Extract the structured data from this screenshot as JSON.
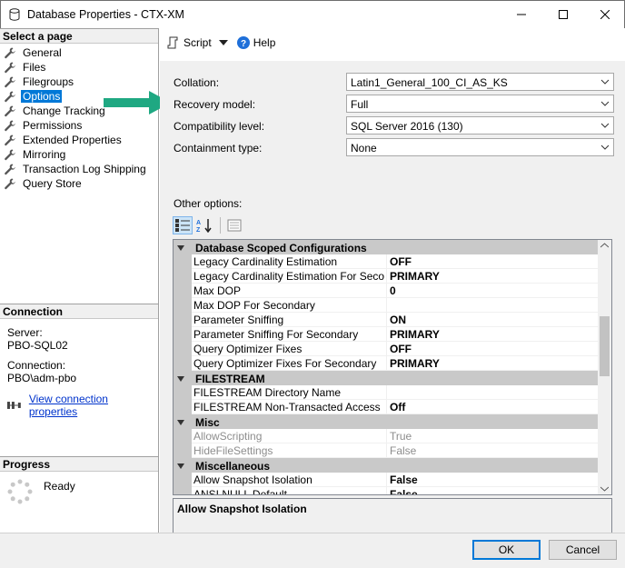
{
  "window": {
    "title": "Database Properties - CTX-XM"
  },
  "left": {
    "select_page_header": "Select a page",
    "pages": [
      {
        "label": "General"
      },
      {
        "label": "Files"
      },
      {
        "label": "Filegroups"
      },
      {
        "label": "Options",
        "selected": true
      },
      {
        "label": "Change Tracking"
      },
      {
        "label": "Permissions"
      },
      {
        "label": "Extended Properties"
      },
      {
        "label": "Mirroring"
      },
      {
        "label": "Transaction Log Shipping"
      },
      {
        "label": "Query Store"
      }
    ],
    "connection_header": "Connection",
    "server_label": "Server:",
    "server_value": "PBO-SQL02",
    "connection_label": "Connection:",
    "connection_value": "PBO\\adm-pbo",
    "view_connection_link": "View connection properties",
    "progress_header": "Progress",
    "progress_status": "Ready"
  },
  "toolbar": {
    "script_label": "Script",
    "help_label": "Help"
  },
  "properties": {
    "collation": {
      "label": "Collation:",
      "value": "Latin1_General_100_CI_AS_KS"
    },
    "recovery_model": {
      "label": "Recovery model:",
      "value": "Full"
    },
    "compatibility_level": {
      "label": "Compatibility level:",
      "value": "SQL Server 2016 (130)"
    },
    "containment_type": {
      "label": "Containment type:",
      "value": "None"
    },
    "other_options_label": "Other options:"
  },
  "grid": {
    "rows": [
      {
        "kind": "cat",
        "name": "Database Scoped Configurations"
      },
      {
        "kind": "prop",
        "name": "Legacy Cardinality Estimation",
        "value": "OFF"
      },
      {
        "kind": "prop",
        "name": "Legacy Cardinality Estimation For Secondary",
        "value": "PRIMARY"
      },
      {
        "kind": "prop",
        "name": "Max DOP",
        "value": "0"
      },
      {
        "kind": "prop",
        "name": "Max DOP For Secondary",
        "value": ""
      },
      {
        "kind": "prop",
        "name": "Parameter Sniffing",
        "value": "ON"
      },
      {
        "kind": "prop",
        "name": "Parameter Sniffing For Secondary",
        "value": "PRIMARY"
      },
      {
        "kind": "prop",
        "name": "Query Optimizer Fixes",
        "value": "OFF"
      },
      {
        "kind": "prop",
        "name": "Query Optimizer Fixes For Secondary",
        "value": "PRIMARY"
      },
      {
        "kind": "cat",
        "name": "FILESTREAM"
      },
      {
        "kind": "prop",
        "name": "FILESTREAM Directory Name",
        "value": ""
      },
      {
        "kind": "prop",
        "name": "FILESTREAM Non-Transacted Access",
        "value": "Off"
      },
      {
        "kind": "cat",
        "name": "Misc"
      },
      {
        "kind": "prop",
        "name": "AllowScripting",
        "value": "True",
        "disabled": true
      },
      {
        "kind": "prop",
        "name": "HideFileSettings",
        "value": "False",
        "disabled": true
      },
      {
        "kind": "cat",
        "name": "Miscellaneous"
      },
      {
        "kind": "prop",
        "name": "Allow Snapshot Isolation",
        "value": "False"
      },
      {
        "kind": "prop",
        "name": "ANSI NULL Default",
        "value": "False"
      }
    ]
  },
  "description": {
    "title": "Allow Snapshot Isolation"
  },
  "buttons": {
    "ok": "OK",
    "cancel": "Cancel"
  },
  "colors": {
    "selection": "#0078d7",
    "arrow": "#1fa882",
    "category_bg": "#c9c9c9"
  }
}
